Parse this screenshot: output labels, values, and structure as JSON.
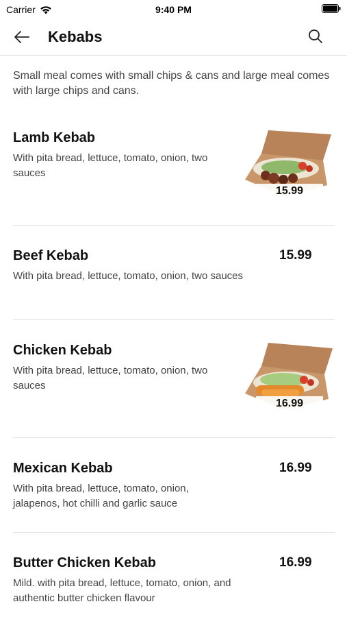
{
  "status_bar": {
    "carrier": "Carrier",
    "time": "9:40 PM"
  },
  "navbar": {
    "title": "Kebabs"
  },
  "intro": "Small meal comes with small chips & cans and large meal comes with large chips and cans.",
  "items": [
    {
      "name": "Lamb Kebab",
      "description": "With pita bread, lettuce, tomato, onion, two sauces",
      "price": "15.99"
    },
    {
      "name": "Beef Kebab",
      "description": "With pita bread, lettuce, tomato, onion, two sauces",
      "price": "15.99"
    },
    {
      "name": "Chicken Kebab",
      "description": "With pita bread, lettuce, tomato, onion, two sauces",
      "price": "16.99"
    },
    {
      "name": "Mexican Kebab",
      "description": "With pita bread, lettuce, tomato, onion, jalapenos, hot chilli and garlic sauce",
      "price": "16.99"
    },
    {
      "name": "Butter Chicken Kebab",
      "description": "Mild. with pita bread, lettuce, tomato, onion, and authentic butter chicken flavour",
      "price": "16.99"
    }
  ]
}
